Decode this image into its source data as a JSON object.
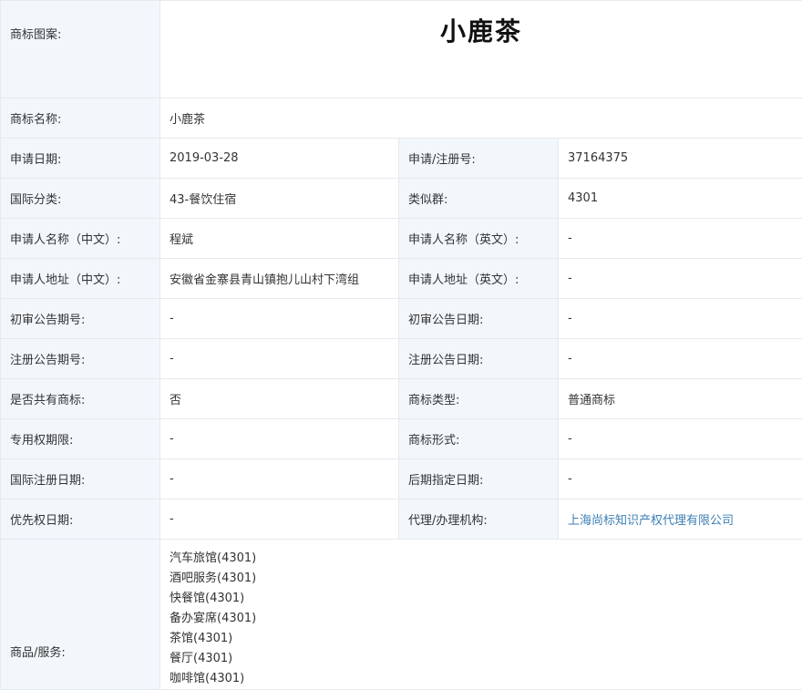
{
  "trademark": {
    "logo_label": "商标图案:",
    "logo_text": "小鹿茶",
    "name_label": "商标名称:",
    "name_value": "小鹿茶"
  },
  "rows": [
    {
      "l1": "申请日期:",
      "v1": "2019-03-28",
      "l2": "申请/注册号:",
      "v2": "37164375"
    },
    {
      "l1": "国际分类:",
      "v1": "43-餐饮住宿",
      "l2": "类似群:",
      "v2": "4301"
    },
    {
      "l1": "申请人名称（中文）:",
      "v1": "程斌",
      "l2": "申请人名称（英文）:",
      "v2": "-"
    },
    {
      "l1": "申请人地址（中文）:",
      "v1": "安徽省金寨县青山镇抱儿山村下湾组",
      "l2": "申请人地址（英文）:",
      "v2": "-"
    },
    {
      "l1": "初审公告期号:",
      "v1": "-",
      "l2": "初审公告日期:",
      "v2": "-"
    },
    {
      "l1": "注册公告期号:",
      "v1": "-",
      "l2": "注册公告日期:",
      "v2": "-"
    },
    {
      "l1": "是否共有商标:",
      "v1": "否",
      "l2": "商标类型:",
      "v2": "普通商标"
    },
    {
      "l1": "专用权期限:",
      "v1": "-",
      "l2": "商标形式:",
      "v2": "-"
    },
    {
      "l1": "国际注册日期:",
      "v1": "-",
      "l2": "后期指定日期:",
      "v2": "-"
    },
    {
      "l1": "优先权日期:",
      "v1": "-",
      "l2": "代理/办理机构:",
      "v2": "上海尚标知识产权代理有限公司"
    }
  ],
  "goods": {
    "label": "商品/服务:",
    "items": [
      "汽车旅馆(4301)",
      "酒吧服务(4301)",
      "快餐馆(4301)",
      "备办宴席(4301)",
      "茶馆(4301)",
      "餐厅(4301)",
      "咖啡馆(4301)"
    ]
  },
  "colors": {
    "label_bg": "#f2f7fc",
    "link": "#3d7fb5",
    "border": "#e6e9ee"
  }
}
